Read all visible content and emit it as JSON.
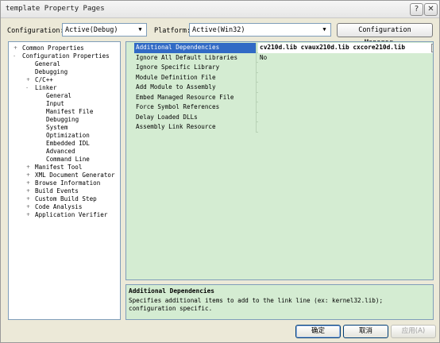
{
  "window": {
    "title": "template Property Pages"
  },
  "titlebar": {
    "help_label": "?",
    "close_label": "✕"
  },
  "config": {
    "configuration_label": "Configuration:",
    "configuration_value": "Active(Debug)",
    "platform_label": "Platform:",
    "platform_value": "Active(Win32)",
    "manager_button": "Configuration Manager..."
  },
  "tree": {
    "items": [
      {
        "label": "Common Properties",
        "expander": "+"
      },
      {
        "label": "Configuration Properties",
        "expander": "-"
      },
      {
        "label": "General",
        "expander": ""
      },
      {
        "label": "Debugging",
        "expander": ""
      },
      {
        "label": "C/C++",
        "expander": "+"
      },
      {
        "label": "Linker",
        "expander": "-"
      },
      {
        "label": "General",
        "expander": ""
      },
      {
        "label": "Input",
        "expander": ""
      },
      {
        "label": "Manifest File",
        "expander": ""
      },
      {
        "label": "Debugging",
        "expander": ""
      },
      {
        "label": "System",
        "expander": ""
      },
      {
        "label": "Optimization",
        "expander": ""
      },
      {
        "label": "Embedded IDL",
        "expander": ""
      },
      {
        "label": "Advanced",
        "expander": ""
      },
      {
        "label": "Command Line",
        "expander": ""
      },
      {
        "label": "Manifest Tool",
        "expander": "+"
      },
      {
        "label": "XML Document Generator",
        "expander": "+"
      },
      {
        "label": "Browse Information",
        "expander": "+"
      },
      {
        "label": "Build Events",
        "expander": "+"
      },
      {
        "label": "Custom Build Step",
        "expander": "+"
      },
      {
        "label": "Code Analysis",
        "expander": "+"
      },
      {
        "label": "Application Verifier",
        "expander": "+"
      }
    ]
  },
  "grid": {
    "rows": [
      {
        "name": "Additional Dependencies",
        "value": "cv210d.lib cvaux210d.lib cxcore210d.lib"
      },
      {
        "name": "Ignore All Default Libraries",
        "value": "No"
      },
      {
        "name": "Ignore Specific Library",
        "value": ""
      },
      {
        "name": "Module Definition File",
        "value": ""
      },
      {
        "name": "Add Module to Assembly",
        "value": ""
      },
      {
        "name": "Embed Managed Resource File",
        "value": ""
      },
      {
        "name": "Force Symbol References",
        "value": ""
      },
      {
        "name": "Delay Loaded DLLs",
        "value": ""
      },
      {
        "name": "Assembly Link Resource",
        "value": ""
      }
    ],
    "ellipsis": "..."
  },
  "description": {
    "title": "Additional Dependencies",
    "text": "Specifies additional items to add to the link line (ex: kernel32.lib); configuration specific."
  },
  "buttons": {
    "ok": "确定",
    "cancel": "取消",
    "apply": "应用(A)"
  },
  "colors": {
    "selection": "#316ac5",
    "grid_background": "#d4ecd2",
    "dialog_background": "#ece9d8"
  }
}
